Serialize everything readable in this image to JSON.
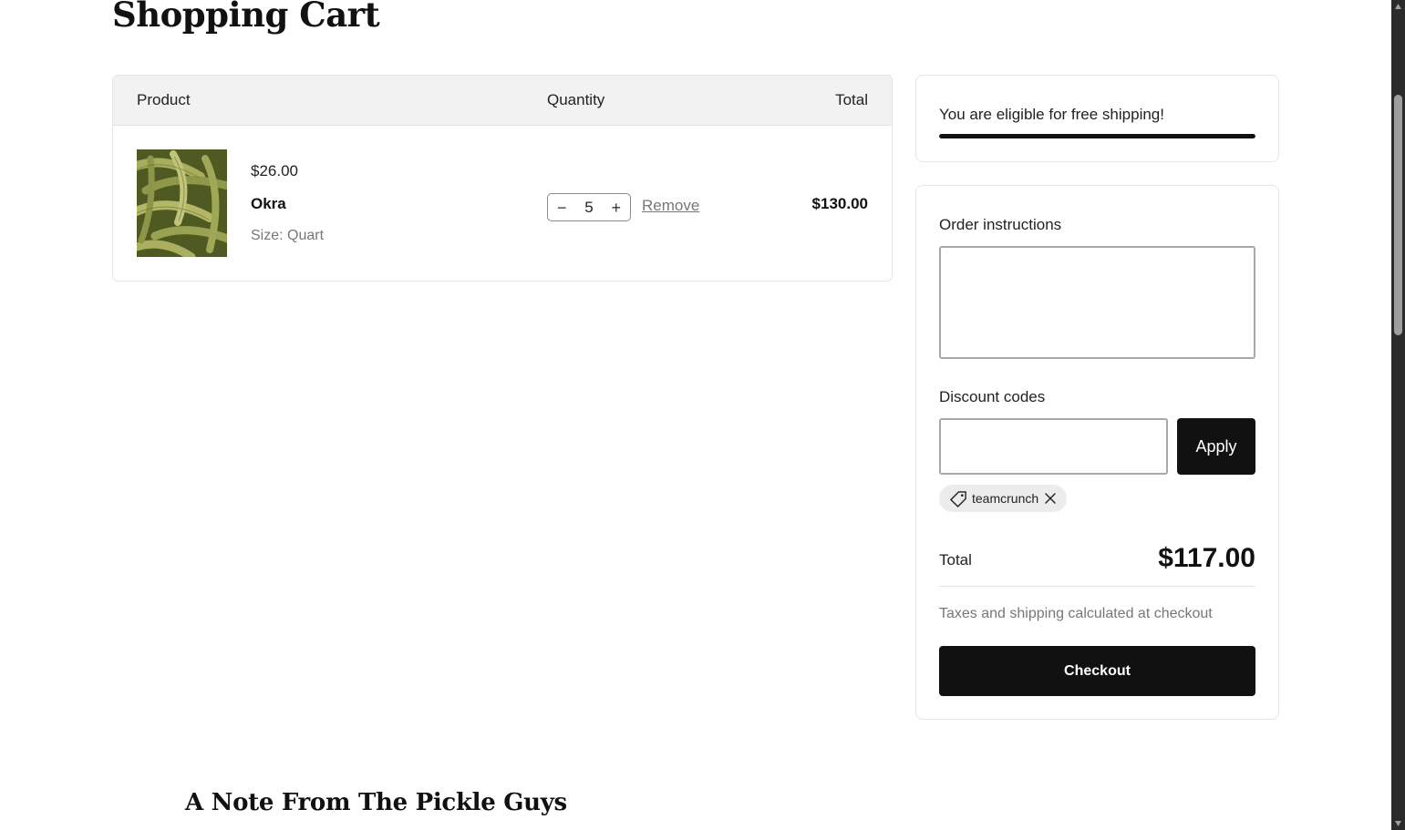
{
  "page": {
    "title": "Shopping Cart"
  },
  "cart": {
    "headers": {
      "product": "Product",
      "quantity": "Quantity",
      "total": "Total"
    },
    "items": [
      {
        "price": "$26.00",
        "name": "Okra",
        "variant": "Size: Quart",
        "quantity": "5",
        "remove_label": "Remove",
        "line_total": "$130.00",
        "image_icon": "okra-product-image"
      }
    ]
  },
  "shipping": {
    "message": "You are eligible for free shipping!",
    "progress": 1.0
  },
  "summary": {
    "order_instructions_label": "Order instructions",
    "order_instructions_value": "",
    "discount_label": "Discount codes",
    "discount_value": "",
    "apply_label": "Apply",
    "applied_codes": [
      "teamcrunch"
    ],
    "total_label": "Total",
    "total_value": "$117.00",
    "tax_note": "Taxes and shipping calculated at checkout",
    "checkout_label": "Checkout"
  },
  "note": {
    "heading": "A Note From The Pickle Guys"
  },
  "colors": {
    "accent": "#111111",
    "muted": "#777777",
    "header_bg": "#f2f2f2"
  }
}
